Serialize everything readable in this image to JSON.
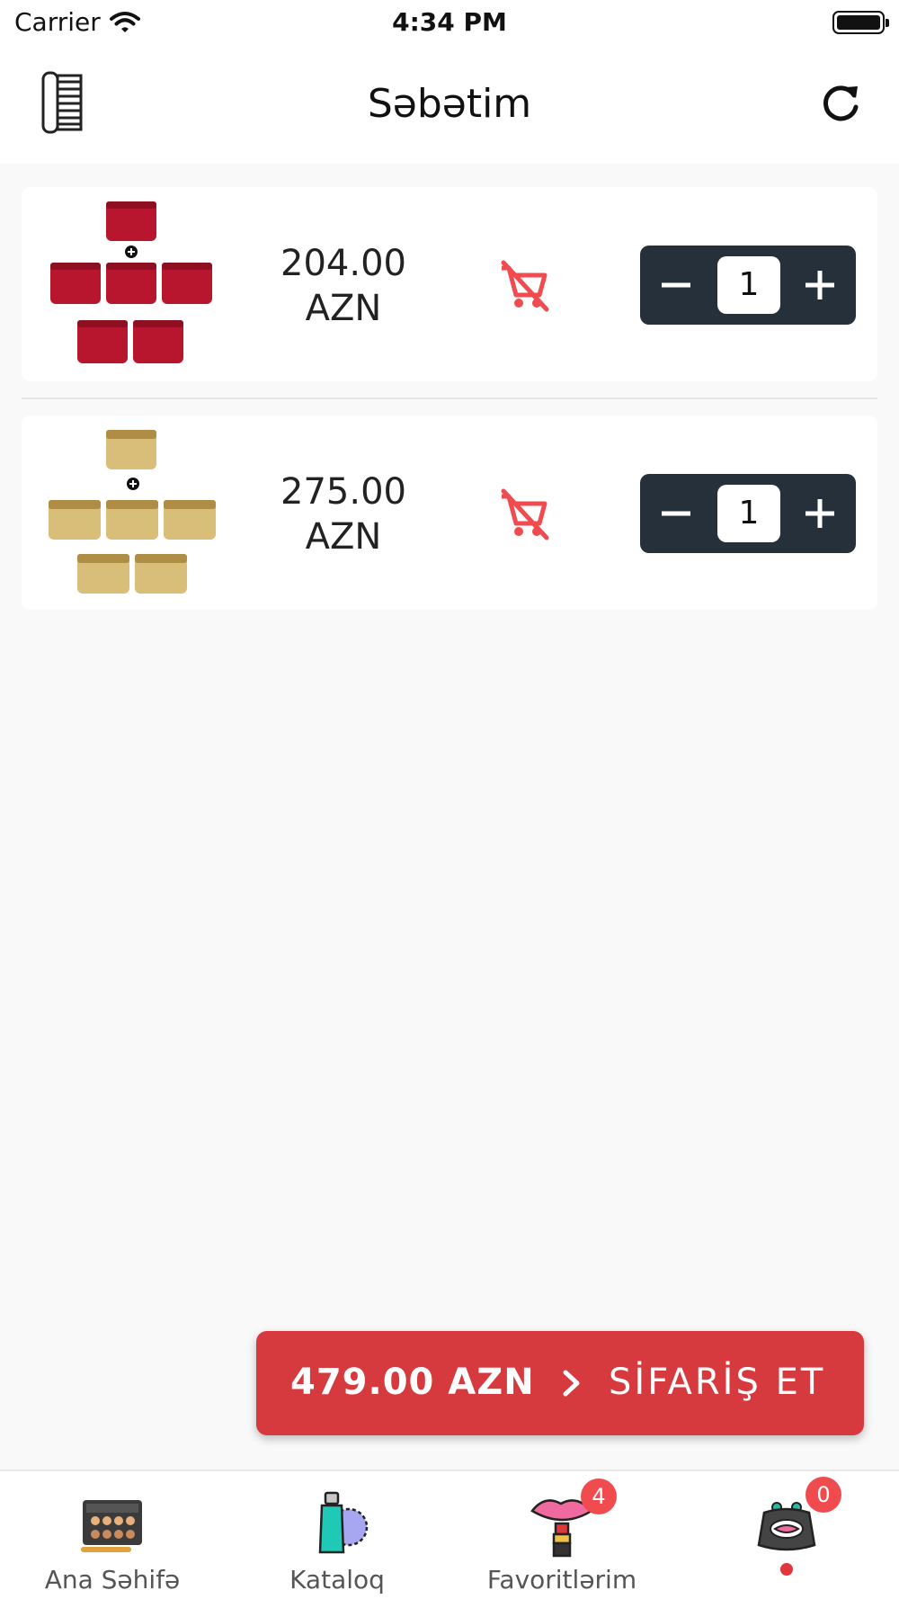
{
  "status_bar": {
    "carrier": "Carrier",
    "time": "4:34 PM"
  },
  "header": {
    "title": "Səbətim"
  },
  "cart": {
    "items": [
      {
        "price_amount": "204.00",
        "price_currency": "AZN",
        "quantity": "1",
        "image_color": "#b8162f"
      },
      {
        "price_amount": "275.00",
        "price_currency": "AZN",
        "quantity": "1",
        "image_color": "#c9a95c"
      }
    ]
  },
  "order_button": {
    "total": "479.00 AZN",
    "label": "SİFARİŞ ET"
  },
  "tab_bar": {
    "tabs": [
      {
        "label": "Ana Səhifə",
        "icon": "palette-icon"
      },
      {
        "label": "Kataloq",
        "icon": "perfume-icon"
      },
      {
        "label": "Favoritlərim",
        "icon": "lipstick-icon",
        "badge": "4"
      },
      {
        "label": "",
        "icon": "purse-icon",
        "badge": "0"
      }
    ]
  },
  "colors": {
    "accent": "#d63a3e",
    "stepper": "#26303a",
    "remove_icon": "#f04c50"
  }
}
